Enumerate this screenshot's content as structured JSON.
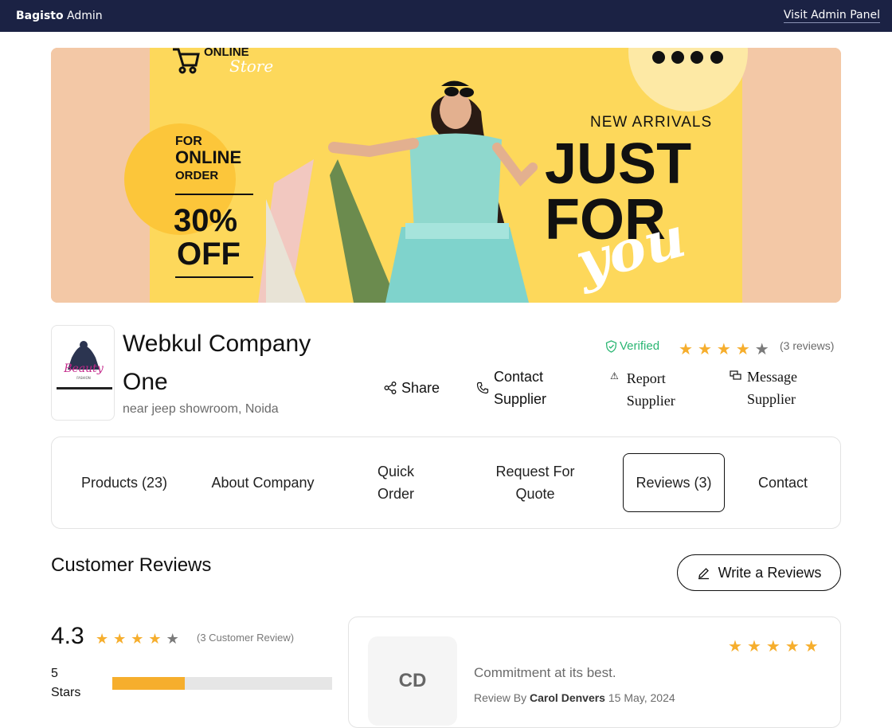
{
  "admin_bar": {
    "brand_bold": "Bagisto",
    "brand_rest": " Admin",
    "visit_link": "Visit Admin Panel"
  },
  "banner": {
    "store_word1": "ONLINE",
    "store_word2": "Store",
    "promo_line1": "FOR",
    "promo_line2": "ONLINE",
    "promo_line3": "ORDER",
    "discount": "30%",
    "discount_suffix": "OFF",
    "new_arrivals": "NEW ARRIVALS",
    "headline1": "JUST",
    "headline2": "FOR",
    "script_word": "you"
  },
  "company": {
    "logo_text": "Beauty",
    "logo_subtext": "FASHION",
    "name": "Webkul Company One",
    "address": "near jeep showroom, Noida",
    "verified_label": "Verified",
    "rating_stars": 4,
    "reviews_label": "(3 reviews)"
  },
  "actions": {
    "share": "Share",
    "contact": "Contact Supplier",
    "report": "Report Supplier",
    "message": "Message Supplier"
  },
  "tabs": [
    {
      "label": "Products (23)",
      "active": false
    },
    {
      "label": "About Company",
      "active": false
    },
    {
      "label": "Quick Order",
      "active": false
    },
    {
      "label": "Request For Quote",
      "active": false
    },
    {
      "label": "Reviews (3)",
      "active": true
    },
    {
      "label": "Contact",
      "active": false
    }
  ],
  "reviews_section": {
    "title": "Customer Reviews",
    "write_button": "Write a Reviews",
    "average": "4.3",
    "average_stars": 4,
    "count_label": "(3 Customer Review)",
    "bars": [
      {
        "label": "5 Stars",
        "fraction": 0.33
      }
    ]
  },
  "review": {
    "initials": "CD",
    "stars": 5,
    "title": "Commitment at its best.",
    "by_prefix": "Review By",
    "author": "Carol Denvers",
    "date": "15 May, 2024"
  },
  "colors": {
    "admin_bar": "#1b2244",
    "star": "#f6ae2d",
    "verified": "#2bb673",
    "banner_yellow": "#fdd85b"
  }
}
